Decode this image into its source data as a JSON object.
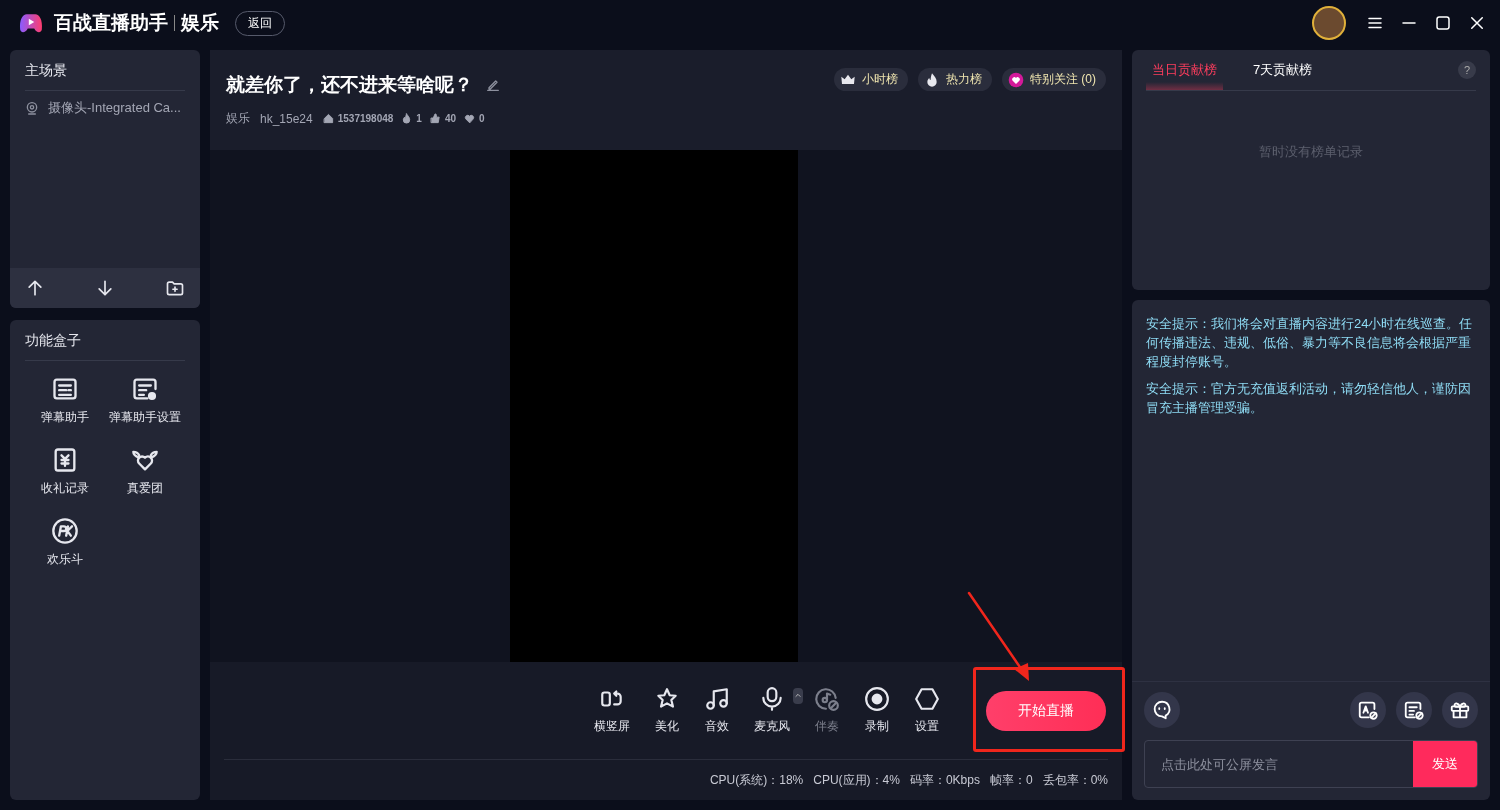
{
  "app": {
    "name": "百战直播助手",
    "category": "娱乐",
    "back_button": "返回"
  },
  "scene_panel": {
    "title": "主场景",
    "items": [
      {
        "label": "摄像头-Integrated Ca..."
      }
    ]
  },
  "function_box": {
    "title": "功能盒子",
    "items": [
      {
        "label": "弹幕助手"
      },
      {
        "label": "弹幕助手设置"
      },
      {
        "label": "收礼记录"
      },
      {
        "label": "真爱团"
      },
      {
        "label": "欢乐斗"
      }
    ]
  },
  "stream": {
    "title": "就差你了，还不进来等啥呢？",
    "category": "娱乐",
    "user": "hk_15e24",
    "room_id": "1537198048",
    "heat": "1",
    "likes": "40",
    "follows": "0",
    "badges": [
      {
        "label": "小时榜"
      },
      {
        "label": "热力榜"
      },
      {
        "label": "特别关注 (0)"
      }
    ]
  },
  "toolbar": [
    {
      "label": "横竖屏",
      "disabled": false
    },
    {
      "label": "美化",
      "disabled": false
    },
    {
      "label": "音效",
      "disabled": false
    },
    {
      "label": "麦克风",
      "disabled": false
    },
    {
      "label": "伴奏",
      "disabled": true
    },
    {
      "label": "录制",
      "disabled": false
    },
    {
      "label": "设置",
      "disabled": false
    }
  ],
  "start_button": "开始直播",
  "status_bar": [
    "CPU(系统)：18%",
    "CPU(应用)：4%",
    "码率：0Kbps",
    "帧率：0",
    "丢包率：0%"
  ],
  "ranking": {
    "tabs": [
      {
        "label": "当日贡献榜",
        "selected": true
      },
      {
        "label": "7天贡献榜",
        "selected": false
      }
    ],
    "help": "?",
    "empty_text": "暂时没有榜单记录"
  },
  "chat": {
    "notices": [
      "安全提示：我们将会对直播内容进行24小时在线巡查。任何传播违法、违规、低俗、暴力等不良信息将会根据严重程度封停账号。",
      "安全提示：官方无充值返利活动，请勿轻信他人，谨防因冒充主播管理受骗。"
    ],
    "placeholder": "点击此处可公屏发言",
    "send_button": "发送"
  },
  "annotation": {
    "frame": true,
    "arrow": true
  }
}
